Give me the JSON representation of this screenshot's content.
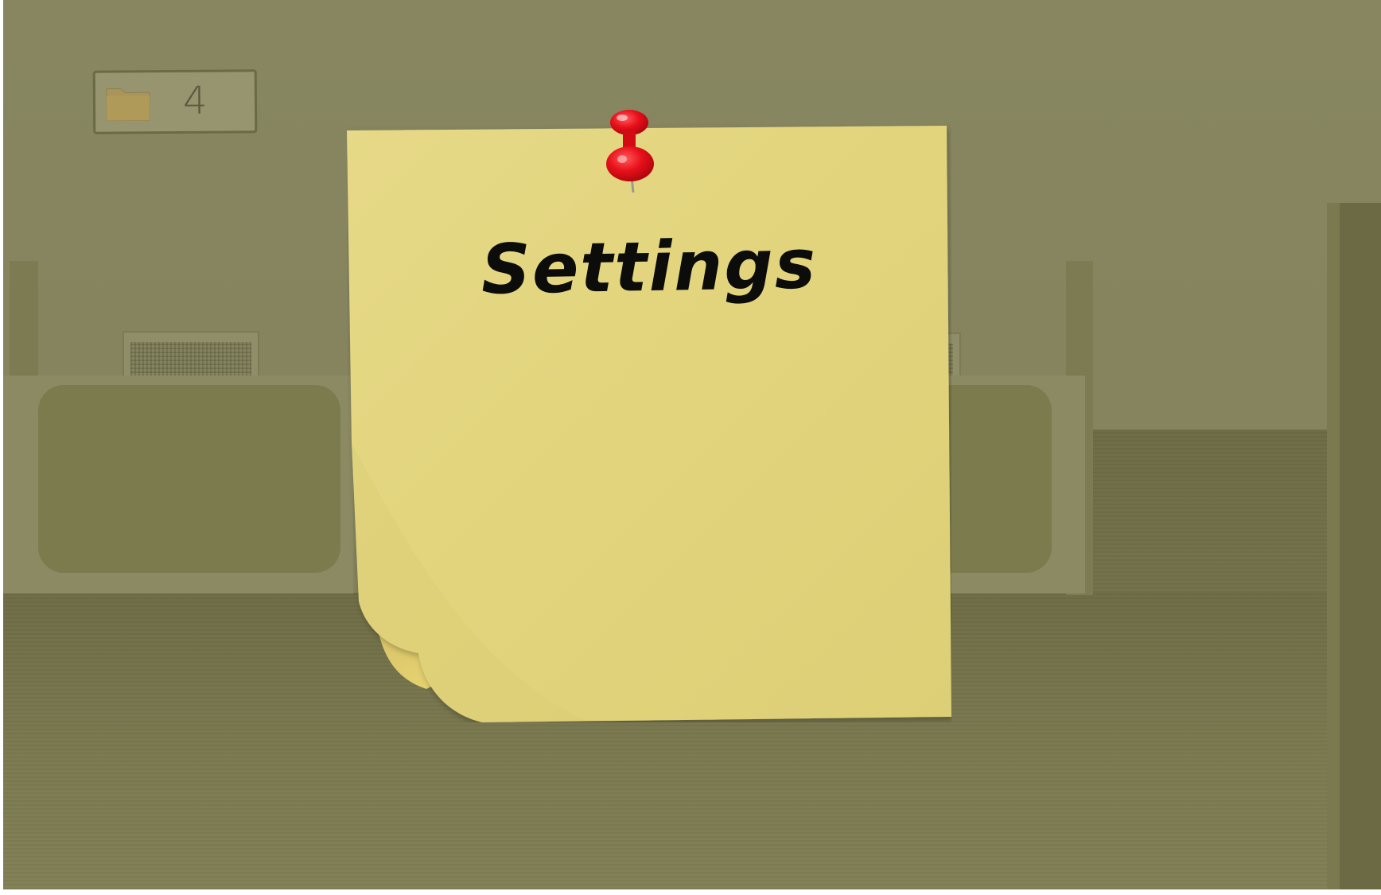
{
  "note": {
    "title": "Settings"
  },
  "folder_counter": {
    "count": "4"
  },
  "colors": {
    "wall": "#878660",
    "floor": "#7b7a50",
    "note": "#e3d57d",
    "pin": "#e8101a"
  },
  "icons": {
    "folder": "folder-icon",
    "pin": "pushpin-icon"
  }
}
